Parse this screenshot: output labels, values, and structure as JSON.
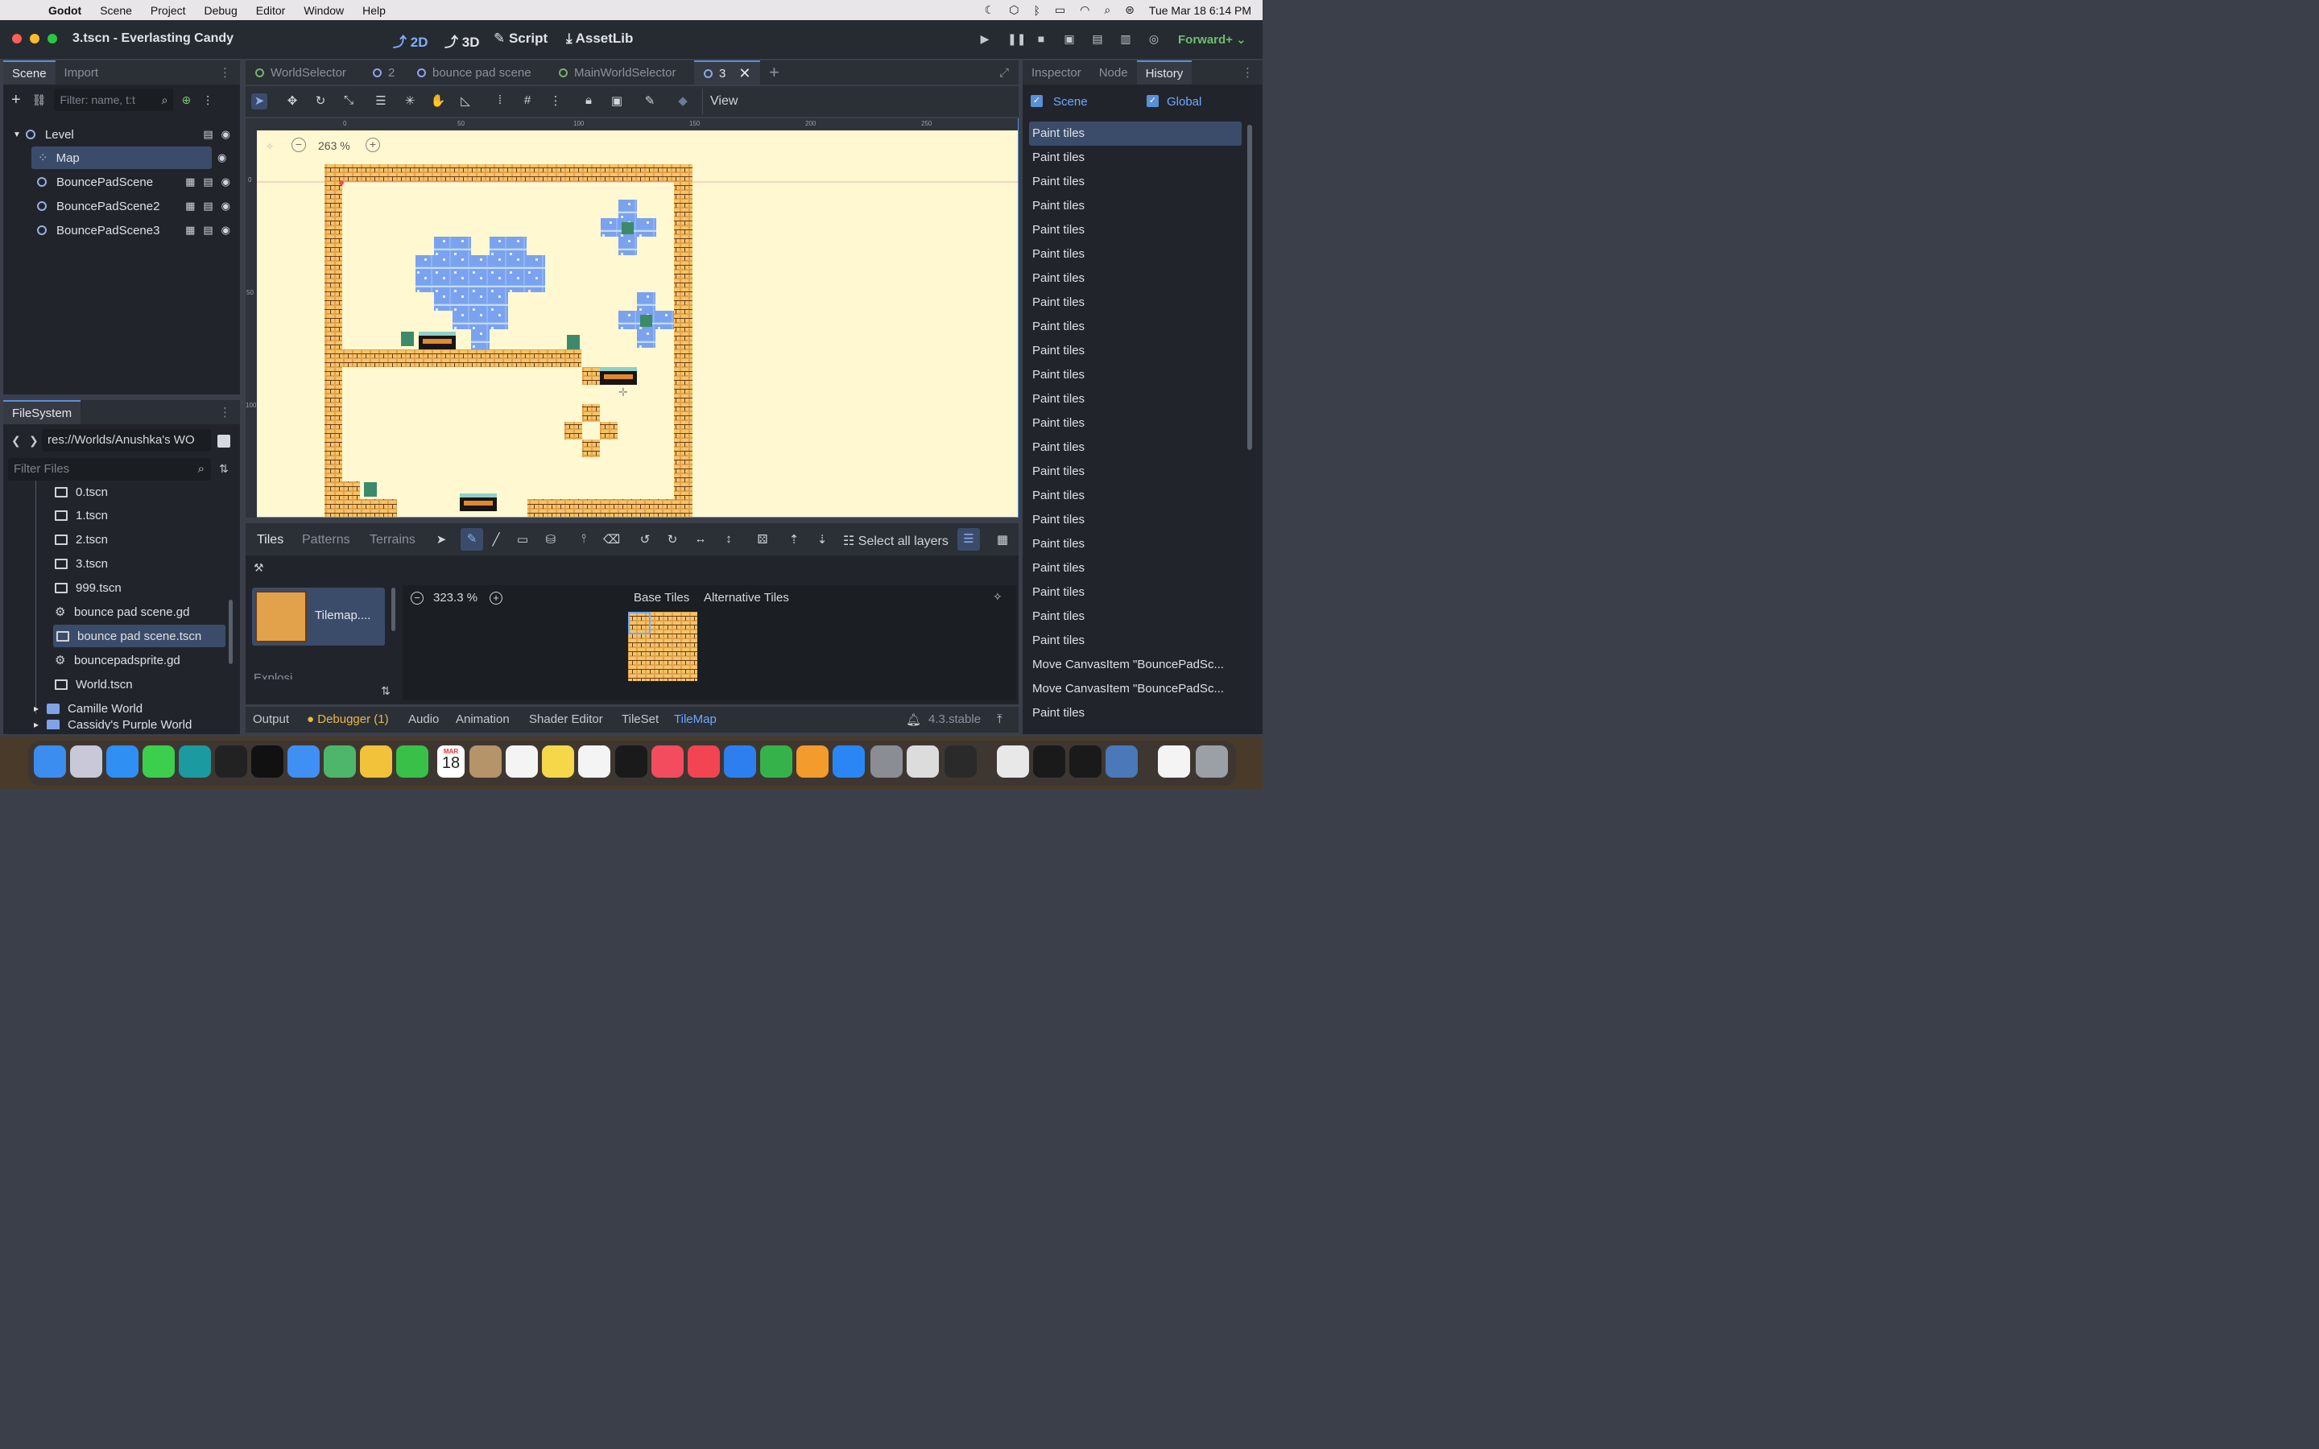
{
  "menubar": {
    "app": "Godot",
    "items": [
      "Scene",
      "Project",
      "Debug",
      "Editor",
      "Window",
      "Help"
    ],
    "clock": "Tue Mar 18  6:14 PM"
  },
  "window": {
    "title": "3.tscn - Everlasting Candy",
    "modes": [
      "2D",
      "3D",
      "Script",
      "AssetLib"
    ],
    "renderer": "Forward+"
  },
  "scene_dock": {
    "tabs": [
      "Scene",
      "Import"
    ],
    "filter_placeholder": "Filter: name, t:t",
    "nodes": [
      {
        "label": "Level"
      },
      {
        "label": "Map"
      },
      {
        "label": "BouncePadScene"
      },
      {
        "label": "BouncePadScene2"
      },
      {
        "label": "BouncePadScene3"
      }
    ]
  },
  "filesystem": {
    "tab": "FileSystem",
    "path": "res://Worlds/Anushka's WO",
    "filter_placeholder": "Filter Files",
    "files": [
      {
        "label": "0.tscn",
        "kind": "scene"
      },
      {
        "label": "1.tscn",
        "kind": "scene"
      },
      {
        "label": "2.tscn",
        "kind": "scene"
      },
      {
        "label": "3.tscn",
        "kind": "scene"
      },
      {
        "label": "999.tscn",
        "kind": "scene"
      },
      {
        "label": "bounce pad scene.gd",
        "kind": "script"
      },
      {
        "label": "bounce pad scene.tscn",
        "kind": "scene"
      },
      {
        "label": "bouncepadsprite.gd",
        "kind": "script"
      },
      {
        "label": "World.tscn",
        "kind": "scene"
      },
      {
        "label": "Camille World",
        "kind": "folder"
      },
      {
        "label": "Cassidy's Purple World",
        "kind": "folder"
      }
    ]
  },
  "editor_tabs": [
    "WorldSelector",
    "2",
    "bounce pad scene",
    "MainWorldSelector",
    "3"
  ],
  "canvas": {
    "zoom": "263 %",
    "view_menu": "View",
    "ruler_top": [
      "0",
      "50",
      "100",
      "150",
      "200",
      "250"
    ],
    "ruler_left": [
      "0",
      "50",
      "100"
    ]
  },
  "tilemap_panel": {
    "tabs": [
      "Tiles",
      "Patterns",
      "Terrains"
    ],
    "select_layers": "Select all layers",
    "source_label": "Tilemap....",
    "source_label2": "Explosi...",
    "atlas_zoom": "323.3 %",
    "atlas_tabs": [
      "Base Tiles",
      "Alternative Tiles"
    ]
  },
  "bottom_bar": {
    "items": [
      "Output",
      "Debugger (1)",
      "Audio",
      "Animation",
      "Shader Editor",
      "TileSet",
      "TileMap"
    ],
    "version": "4.3.stable"
  },
  "right_dock": {
    "tabs": [
      "Inspector",
      "Node",
      "History"
    ],
    "scene_check": "Scene",
    "global_check": "Global",
    "history": [
      "Paint tiles",
      "Paint tiles",
      "Paint tiles",
      "Paint tiles",
      "Paint tiles",
      "Paint tiles",
      "Paint tiles",
      "Paint tiles",
      "Paint tiles",
      "Paint tiles",
      "Paint tiles",
      "Paint tiles",
      "Paint tiles",
      "Paint tiles",
      "Paint tiles",
      "Paint tiles",
      "Paint tiles",
      "Paint tiles",
      "Paint tiles",
      "Paint tiles",
      "Paint tiles",
      "Paint tiles",
      "Move CanvasItem \"BouncePadSc...",
      "Move CanvasItem \"BouncePadSc...",
      "Paint tiles"
    ]
  },
  "dock_calendar": {
    "month": "MAR",
    "day": "18"
  },
  "colors": {
    "accent": "#5a8fd8",
    "viewport_bg": "#fff8d0",
    "tile": "#d9903a",
    "bounce": "#8fb4f5"
  }
}
